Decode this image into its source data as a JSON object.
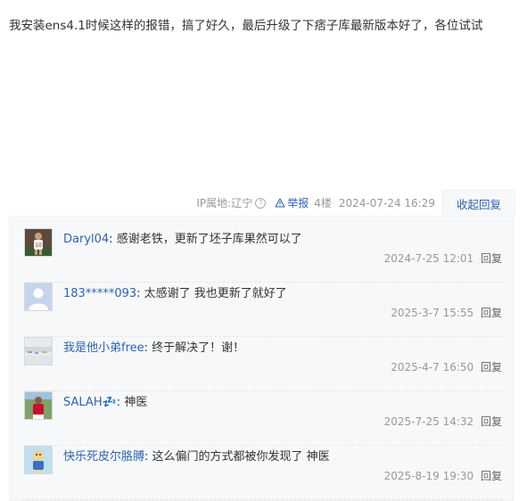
{
  "post": {
    "content": "我安装ens4.1时候这样的报错，搞了好久，最后升级了下痞子库最新版本好了，各位试试"
  },
  "post_tail": {
    "ip_label": "IP属地:辽宁",
    "help_icon": "question-circle-icon",
    "report_icon": "warning-triangle-icon",
    "report_label": "举报",
    "floor": "4楼",
    "date": "2024-07-24 16:29",
    "collapse_label": "收起回复"
  },
  "replies": [
    {
      "user": "Daryl04",
      "text": "感谢老铁，更新了坯子库果然可以了",
      "time": "2024-7-25 12:01",
      "reply_label": "回复"
    },
    {
      "user": "183*****093",
      "text": "太感谢了 我也更新了就好了",
      "time": "2025-3-7 15:55",
      "reply_label": "回复"
    },
    {
      "user": "我是他小弟free",
      "text": "终于解决了！谢！",
      "time": "2025-4-7 16:50",
      "reply_label": "回复"
    },
    {
      "user": "SALAH💤",
      "text": "神医",
      "time": "2025-7-25 14:32",
      "reply_label": "回复"
    },
    {
      "user": "快乐死皮尔胳膊",
      "text": "这么偏门的方式都被你发现了 神医",
      "time": "2025-8-19 19:30",
      "reply_label": "回复"
    }
  ],
  "colors": {
    "link": "#2d64b3",
    "muted": "#999999",
    "reply_bg": "#f7f8fa"
  }
}
